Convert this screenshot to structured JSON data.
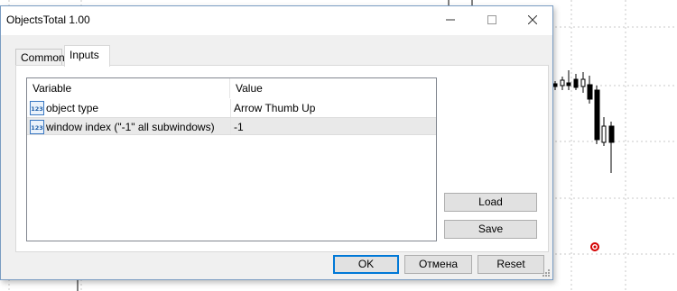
{
  "window": {
    "title": "ObjectsTotal 1.00"
  },
  "tabs": [
    {
      "label": "Common"
    },
    {
      "label": "Inputs"
    }
  ],
  "grid": {
    "headers": {
      "variable": "Variable",
      "value": "Value"
    },
    "rows": [
      {
        "icon": "int-type-icon",
        "variable": "object type",
        "value": "Arrow Thumb Up"
      },
      {
        "icon": "int-type-icon",
        "variable": "window index (\"-1\" all subwindows)",
        "value": "-1"
      }
    ]
  },
  "buttons": {
    "load": "Load",
    "save": "Save",
    "ok": "OK",
    "cancel": "Отмена",
    "reset": "Reset"
  },
  "colors": {
    "accent": "#0078d7",
    "chart_bg": "#ffffff",
    "grid_dots": "#c8c8c8",
    "candle": "#000000",
    "arrow_marker": "#d40000"
  }
}
